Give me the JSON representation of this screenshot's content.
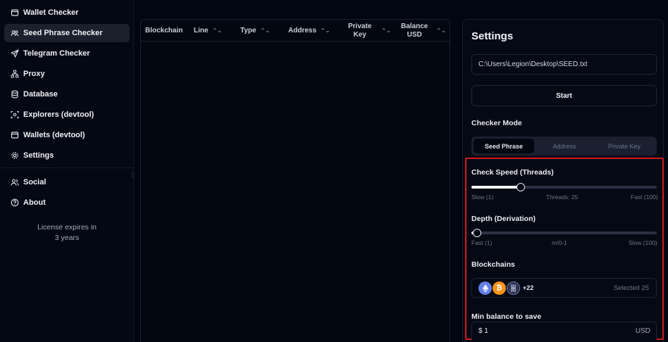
{
  "sidebar": {
    "items": [
      {
        "label": "Wallet Checker",
        "icon": "wallet-icon"
      },
      {
        "label": "Seed Phrase Checker",
        "icon": "users-icon"
      },
      {
        "label": "Telegram Checker",
        "icon": "send-icon"
      },
      {
        "label": "Proxy",
        "icon": "network-icon"
      },
      {
        "label": "Database",
        "icon": "database-icon"
      },
      {
        "label": "Explorers (devtool)",
        "icon": "scan-icon"
      },
      {
        "label": "Wallets (devtool)",
        "icon": "wallet-icon"
      },
      {
        "label": "Settings",
        "icon": "gear-icon"
      },
      {
        "label": "Social",
        "icon": "social-icon"
      },
      {
        "label": "About",
        "icon": "help-icon"
      }
    ],
    "license_line1": "License expires in",
    "license_line2": "3 years"
  },
  "table": {
    "columns": [
      "Blockchain",
      "Line",
      "Type",
      "Address",
      "Private Key",
      "Balance USD"
    ],
    "col_private_1": "Private",
    "col_private_2": "Key",
    "col_balance_1": "Balance",
    "col_balance_2": "USD",
    "rows": []
  },
  "settings": {
    "title": "Settings",
    "file_path": "C:\\Users\\Legion\\Desktop\\SEED.txt",
    "start_label": "Start",
    "checker_mode_label": "Checker Mode",
    "modes": [
      "Seed Phrase",
      "Address",
      "Private Key"
    ],
    "active_mode": "Seed Phrase",
    "speed": {
      "label": "Check Speed (Threads)",
      "min_label": "Slow (1)",
      "value_label": "Threads: 25",
      "max_label": "Fast (100)",
      "value": 25,
      "min": 1,
      "max": 100
    },
    "depth": {
      "label": "Depth (Derivation)",
      "min_label": "Fast (1)",
      "value_label": "m/0-1",
      "max_label": "Slow (100)",
      "value": 1,
      "min": 1,
      "max": 100
    },
    "blockchains": {
      "label": "Blockchains",
      "coin_icons": [
        "ethereum-icon",
        "bitcoin-icon",
        "cosmos-icon"
      ],
      "more": "+22",
      "selected": "Selected 25"
    },
    "min_balance": {
      "label": "Min balance to save",
      "value": "$ 1",
      "unit": "USD"
    }
  },
  "colors": {
    "background": "#020611",
    "highlight_border": "#d11a1e",
    "ethereum": "#627eea",
    "bitcoin": "#f7931a",
    "cosmos": "#2e3148"
  }
}
